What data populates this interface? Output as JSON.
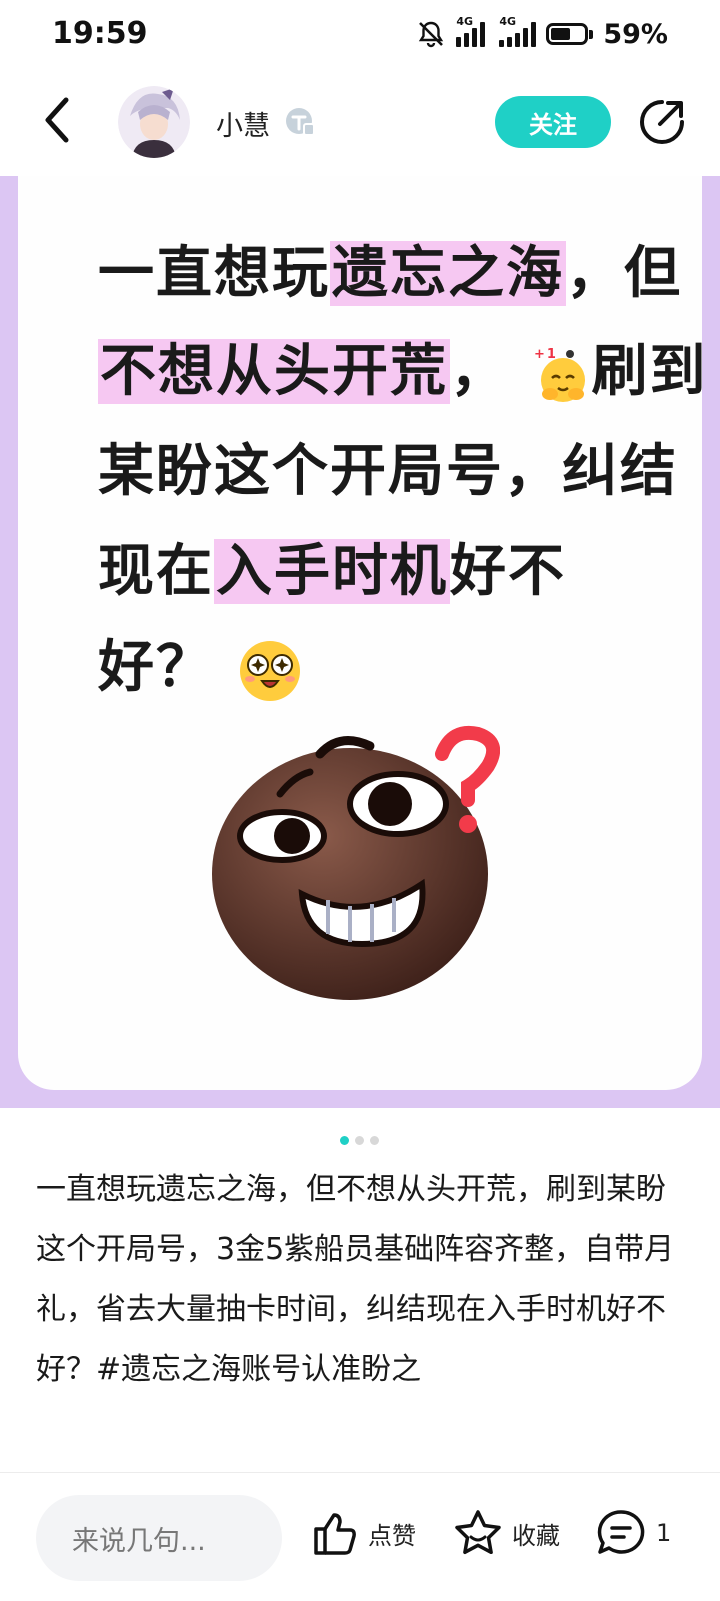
{
  "status_bar": {
    "time": "19:59",
    "network_1": "4G",
    "network_2": "4G",
    "battery_percent": "59%",
    "battery_level": 0.59,
    "icons": [
      "mute-bell-icon",
      "signal-icon",
      "signal-icon",
      "battery-icon"
    ]
  },
  "header": {
    "author_name": "小慧",
    "follow_label": "关注",
    "icons": [
      "back-icon",
      "avatar",
      "badge-icon",
      "share-icon"
    ],
    "accent_color": "#1fd0c6"
  },
  "post_image": {
    "background_color": "#dcc6f3",
    "lines": {
      "line1_a": "一直想玩",
      "line1_hl": "遗忘之海",
      "line1_b": "，但",
      "line2_hl": "不想从头开荒",
      "line2_b": "，",
      "line2_c": "刷到",
      "line3": "某盼这个开局号，纠结",
      "line4_a": "现在",
      "line4_hl": "入手时机",
      "line4_b": "好不",
      "line5": "好？"
    },
    "emojis": [
      "hug-plus-one-emoji",
      "star-eyes-emoji",
      "nervous-brown-face-emoji"
    ],
    "page_count": 3,
    "current_page": 1
  },
  "caption": {
    "text": "一直想玩遗忘之海，但不想从头开荒，刷到某盼这个开局号，3金5紫船员基础阵容齐整，自带月礼，省去大量抽卡时间，纠结现在入手时机好不好？#遗忘之海账号认准盼之"
  },
  "bottom_bar": {
    "comment_placeholder": "来说几句...",
    "like_label": "点赞",
    "favorite_label": "收藏",
    "comment_count": "1",
    "icons": [
      "thumbs-up-icon",
      "star-icon",
      "comment-icon"
    ]
  }
}
